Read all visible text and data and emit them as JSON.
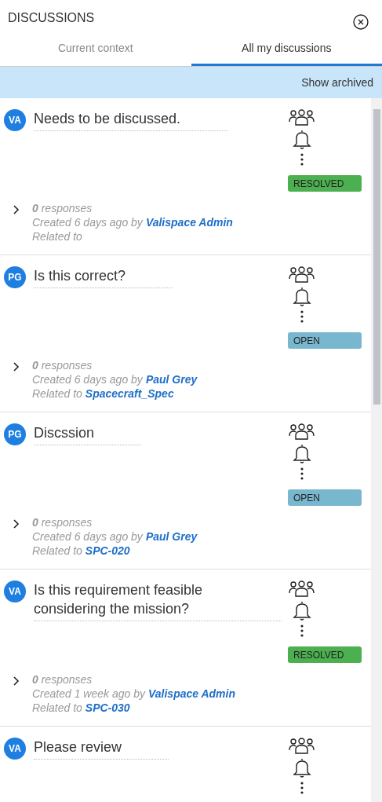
{
  "header": {
    "title": "DISCUSSIONS"
  },
  "tabs": [
    {
      "label": "Current context",
      "selected": false
    },
    {
      "label": "All my discussions",
      "selected": true
    }
  ],
  "toolbar": {
    "show_archived": "Show archived"
  },
  "discussions": [
    {
      "initials": "VA",
      "title": "Needs to be discussed.",
      "status": {
        "label": "RESOLVED",
        "color": "#4caf50"
      },
      "responses": "**0** responses",
      "created": "Created 6 days ago by",
      "author": "Valispace Admin",
      "related_label": "Related to"
    },
    {
      "initials": "PG",
      "title": "Is this correct?",
      "status": {
        "label": "OPEN",
        "color": "#79b7cf"
      },
      "responses": "**0** responses",
      "created": "Created 6 days ago by",
      "author": "Paul Grey",
      "related_label": "Related to",
      "related_link": "Spacecraft_Spec"
    },
    {
      "initials": "PG",
      "title": "Discssion",
      "status": {
        "label": "OPEN",
        "color": "#79b7cf"
      },
      "responses": "**0** responses",
      "created": "Created 6 days ago by",
      "author": "Paul Grey",
      "related_label": "Related to",
      "related_link": "SPC-020"
    },
    {
      "initials": "VA",
      "title": "Is this requirement feasible considering the mission?",
      "status": {
        "label": "RESOLVED",
        "color": "#4caf50"
      },
      "responses": "**0** responses",
      "created": "Created 1 week ago by",
      "author": "Valispace Admin",
      "related_label": "Related to",
      "related_link": "SPC-030"
    },
    {
      "initials": "VA",
      "title": "Please review"
    }
  ]
}
